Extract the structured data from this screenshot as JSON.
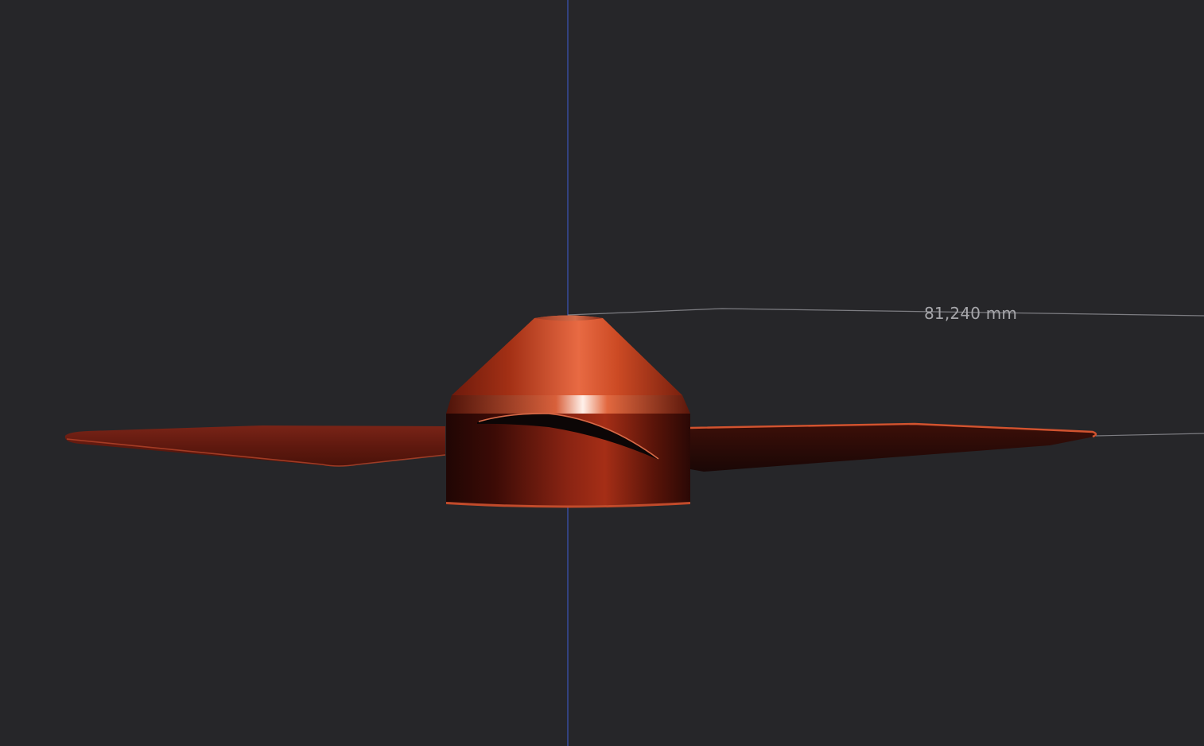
{
  "viewport": {
    "background_color": "#262629",
    "axis_color": "#3b55b8",
    "dimension_line_color": "#8a8a8e",
    "model_color": "#b33a1f"
  },
  "dimension": {
    "label": "81,240 mm"
  }
}
